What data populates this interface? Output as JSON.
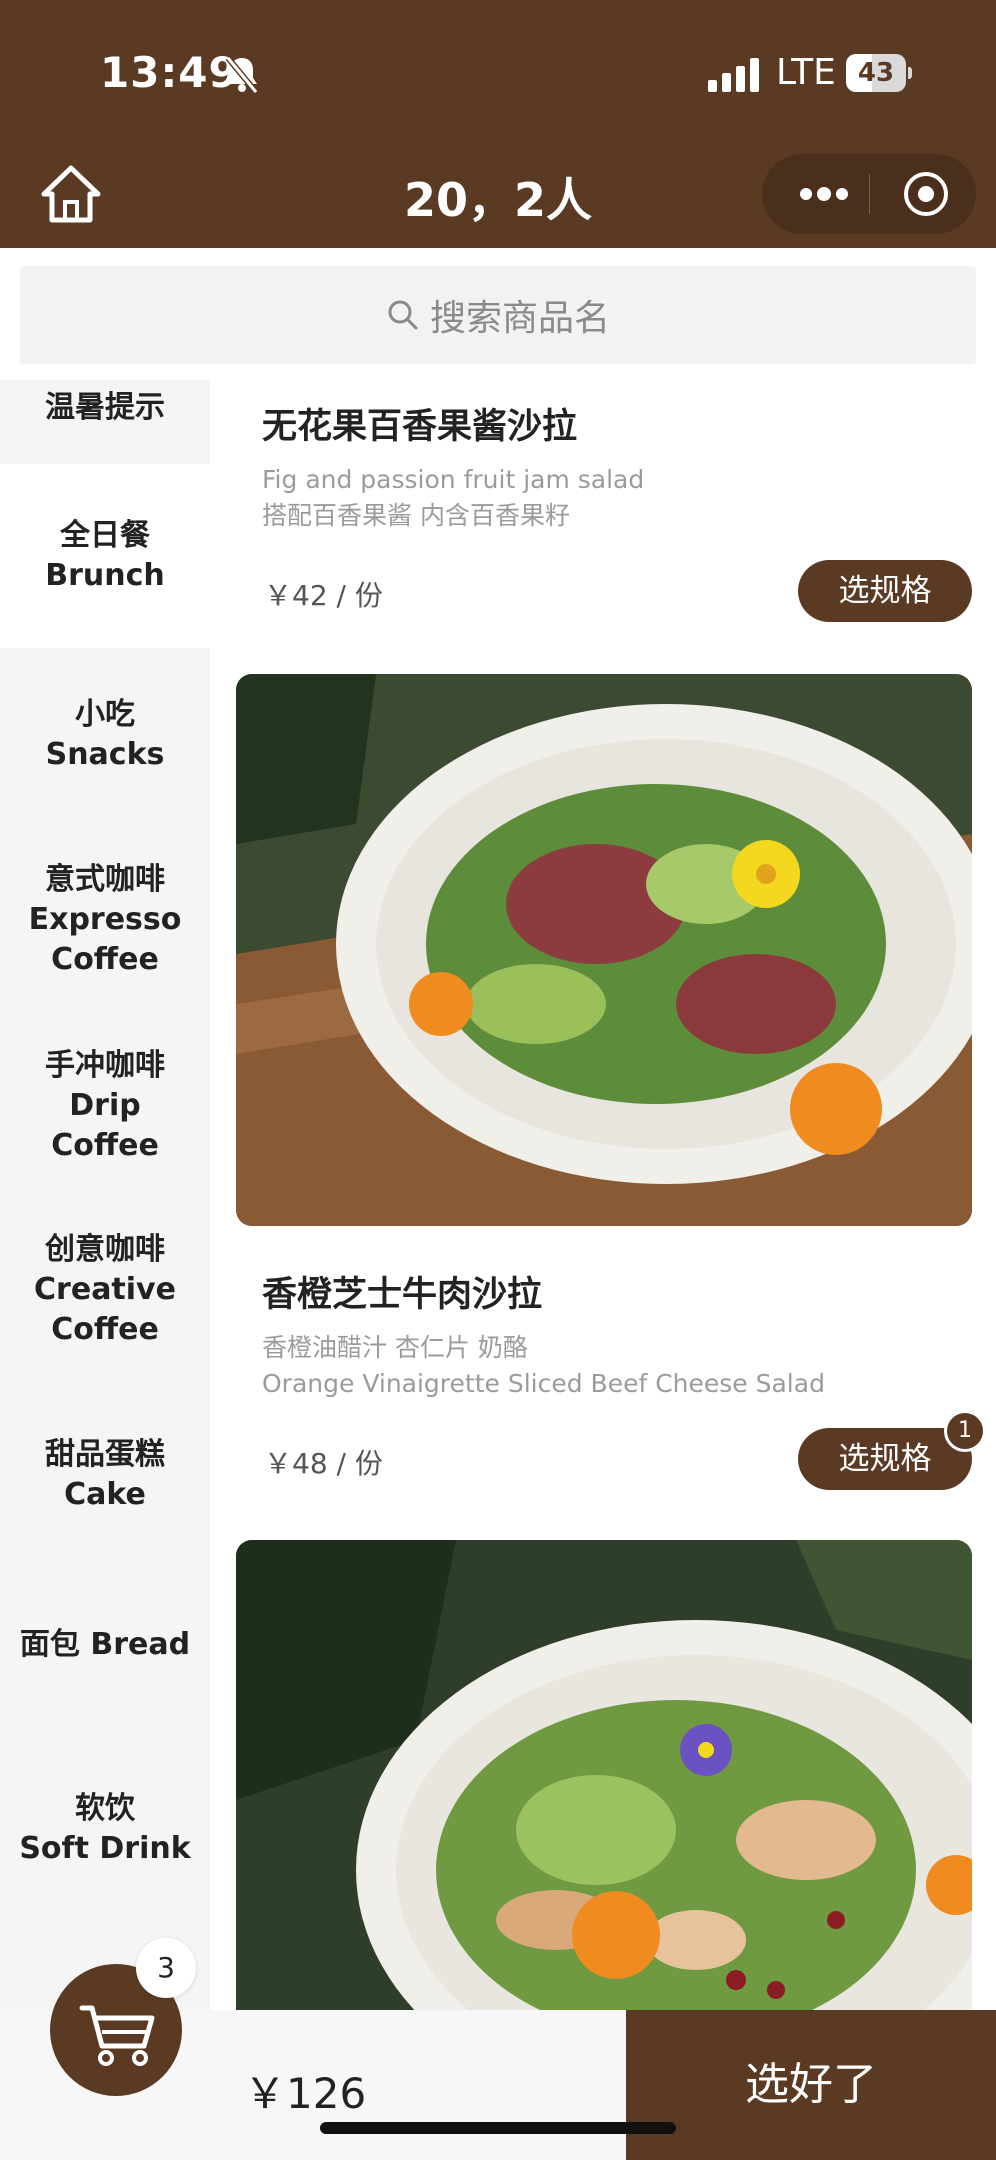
{
  "colors": {
    "brand": "#5b3a24",
    "muted_text": "#9b9b9b",
    "sidebar_bg": "#f5f5f5"
  },
  "status_bar": {
    "time": "13:49",
    "network": "LTE",
    "battery": "43",
    "battery_level": 0.43,
    "icons": [
      "bell-slash-icon",
      "signal-bars-icon",
      "battery-icon"
    ]
  },
  "nav": {
    "title": "20，2人",
    "icons": [
      "home-icon",
      "more-dots-icon",
      "target-close-icon"
    ]
  },
  "search": {
    "placeholder": "搜索商品名",
    "icon": "search-icon"
  },
  "sidebar": {
    "items": [
      {
        "label": "温暑提示",
        "active": false
      },
      {
        "label": "全日餐\nBrunch",
        "active": true
      },
      {
        "label": "小吃\nSnacks",
        "active": false
      },
      {
        "label": "意式咖啡\nExpresso\nCoffee",
        "active": false
      },
      {
        "label": "手冲咖啡\nDrip\nCoffee",
        "active": false
      },
      {
        "label": "创意咖啡\nCreative\nCoffee",
        "active": false
      },
      {
        "label": "甜品蛋糕\nCake",
        "active": false
      },
      {
        "label": "面包 Bread",
        "active": false
      },
      {
        "label": "软饮\nSoft Drink",
        "active": false
      }
    ]
  },
  "products": [
    {
      "name": "无花果百香果酱沙拉",
      "desc_line1": "Fig and passion fruit jam salad",
      "desc_line2": "搭配百香果酱 内含百香果籽",
      "price": "￥42 / 份",
      "button": "选规格"
    },
    {
      "name": "香橙芝士牛肉沙拉",
      "desc_line1": "香橙油醋汁 杏仁片 奶酪",
      "desc_line2": "Orange Vinaigrette Sliced Beef Cheese Salad",
      "price": "￥48 / 份",
      "button": "选规格",
      "badge": "1"
    },
    {
      "name": ""
    }
  ],
  "cart": {
    "count": "3",
    "total": "￥126",
    "checkout_label": "选好了",
    "icon": "shopping-cart-icon"
  }
}
